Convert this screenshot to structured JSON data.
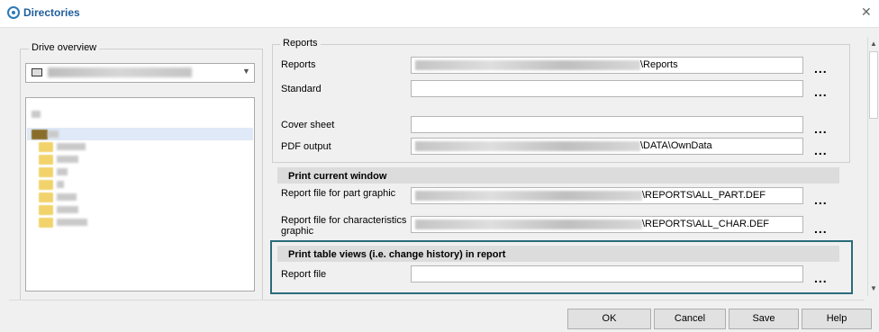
{
  "window": {
    "title": "Directories"
  },
  "drive_overview": {
    "label": "Drive overview"
  },
  "reports": {
    "group_label": "Reports",
    "rows": [
      {
        "label": "Reports",
        "value_suffix": "\\Reports"
      },
      {
        "label": "Standard",
        "value_suffix": ""
      },
      {
        "label": "Cover sheet",
        "value_suffix": ""
      },
      {
        "label": "PDF output",
        "value_suffix": "\\DATA\\OwnData"
      }
    ]
  },
  "print_current_window": {
    "heading": "Print current window",
    "rows": [
      {
        "label": "Report file for part graphic",
        "value_suffix": "\\REPORTS\\ALL_PART.DEF"
      },
      {
        "label": "Report file for characteristics graphic",
        "value_suffix": "\\REPORTS\\ALL_CHAR.DEF"
      }
    ]
  },
  "print_table_views": {
    "heading": "Print table views (i.e. change history) in report",
    "rows": [
      {
        "label": "Report file",
        "value_suffix": ""
      }
    ]
  },
  "ellipsis": "...",
  "buttons": {
    "ok": "OK",
    "cancel": "Cancel",
    "save": "Save",
    "help": "Help"
  },
  "colors": {
    "highlight_border": "#2b6b7a",
    "title_color": "#1f5e9c"
  }
}
